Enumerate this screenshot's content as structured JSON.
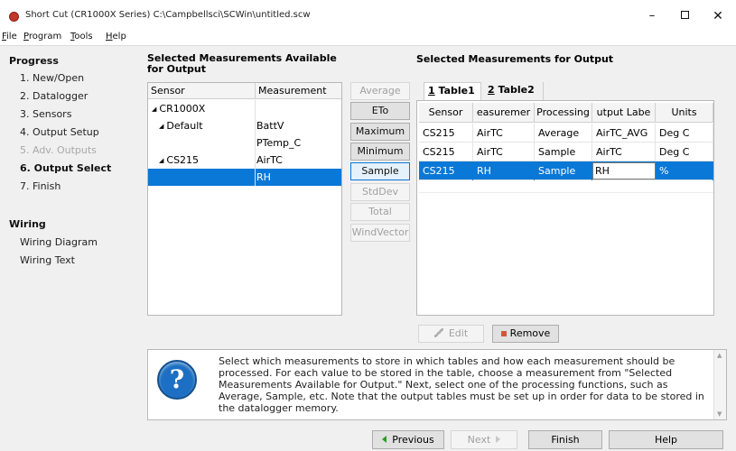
{
  "window": {
    "title": "Short Cut (CR1000X Series) C:\\Campbellsci\\SCWin\\untitled.scw",
    "minimize": "–",
    "close": "✕"
  },
  "menu": [
    {
      "key": "F",
      "rest": "ile"
    },
    {
      "key": "P",
      "rest": "rogram"
    },
    {
      "key": "T",
      "rest": "ools"
    },
    {
      "key": "H",
      "rest": "elp"
    }
  ],
  "sidebar": {
    "progress_heading": "Progress",
    "items": [
      {
        "label": "1. New/Open",
        "state": "normal"
      },
      {
        "label": "2. Datalogger",
        "state": "normal"
      },
      {
        "label": "3. Sensors",
        "state": "normal"
      },
      {
        "label": "4. Output Setup",
        "state": "normal"
      },
      {
        "label": "5. Adv. Outputs",
        "state": "disabled"
      },
      {
        "label": "6. Output Select",
        "state": "active"
      },
      {
        "label": "7. Finish",
        "state": "normal"
      }
    ],
    "wiring_heading": "Wiring",
    "wiring_items": [
      {
        "label": "Wiring Diagram"
      },
      {
        "label": "Wiring Text"
      }
    ]
  },
  "available": {
    "title": "Selected Measurements Available for Output",
    "col_sensor": "Sensor",
    "col_measurement": "Measurement",
    "rows": [
      {
        "sensor": "CR1000X",
        "measurement": "",
        "indent": 0,
        "expander": "◢"
      },
      {
        "sensor": "Default",
        "measurement": "BattV",
        "indent": 1,
        "expander": "◢"
      },
      {
        "sensor": "",
        "measurement": "PTemp_C",
        "indent": 2,
        "expander": ""
      },
      {
        "sensor": "CS215",
        "measurement": "AirTC",
        "indent": 1,
        "expander": "◢"
      },
      {
        "sensor": "",
        "measurement": "RH",
        "indent": 2,
        "expander": "",
        "selected": true
      }
    ]
  },
  "functions": [
    {
      "label": "Average",
      "state": "disabled"
    },
    {
      "label": "ETo",
      "state": "normal"
    },
    {
      "label": "Maximum",
      "state": "normal"
    },
    {
      "label": "Minimum",
      "state": "normal"
    },
    {
      "label": "Sample",
      "state": "focused"
    },
    {
      "label": "StdDev",
      "state": "disabled"
    },
    {
      "label": "Total",
      "state": "disabled"
    },
    {
      "label": "WindVector",
      "state": "disabled"
    }
  ],
  "output": {
    "title": "Selected Measurements for Output",
    "tabs": [
      {
        "num": "1",
        "label": " Table1"
      },
      {
        "num": "2",
        "label": " Table2"
      }
    ],
    "columns": [
      "Sensor",
      "easuremer",
      "Processing",
      "utput Labe",
      "Units"
    ],
    "rows": [
      {
        "sensor": "CS215",
        "measurement": "AirTC",
        "processing": "Average",
        "label": "AirTC_AVG",
        "units": "Deg C"
      },
      {
        "sensor": "CS215",
        "measurement": "AirTC",
        "processing": "Sample",
        "label": "AirTC",
        "units": "Deg C"
      },
      {
        "sensor": "CS215",
        "measurement": "RH",
        "processing": "Sample",
        "label": "RH",
        "units": "%",
        "selected": true
      }
    ],
    "edit_label": "Edit",
    "remove_label": "Remove"
  },
  "help": {
    "icon": "?",
    "text": "Select which measurements to store in which tables and how each measurement should be processed. For each value to be stored in the table, choose a measurement from \"Selected Measurements Available for Output.\" Next, select one of the processing functions, such as Average, Sample, etc. Note that the output tables must be set up in order for data to be stored in the datalogger memory."
  },
  "nav": {
    "previous": "Previous",
    "next": "Next",
    "finish": "Finish",
    "help": "Help"
  },
  "colors": {
    "selection": "#0a78d7",
    "panel_bg": "#f0f0f0",
    "help_icon": "#1c6fc2"
  }
}
